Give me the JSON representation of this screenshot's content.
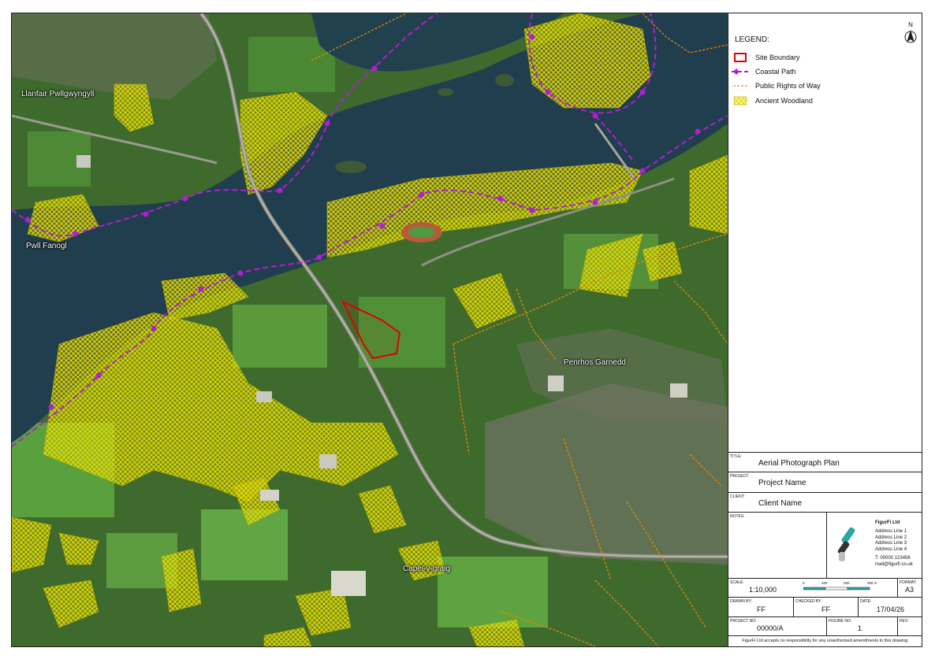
{
  "map": {
    "places": [
      {
        "name": "Llanfair Pwllgwyngyll"
      },
      {
        "name": "Pwll Fanogl"
      },
      {
        "name": "Penrhos Garnedd"
      },
      {
        "name": "Capel-y-graig"
      }
    ]
  },
  "legend": {
    "title": "LEGEND:",
    "items": [
      {
        "label": "Site Boundary",
        "color": "#e00000"
      },
      {
        "label": "Coastal Path",
        "color": "#b01fd0"
      },
      {
        "label": "Public Rights of Way",
        "color": "#f08a00"
      },
      {
        "label": "Ancient Woodland",
        "color": "#f2e600"
      }
    ]
  },
  "north_label": "N",
  "title_block": {
    "title_caption": "TITLE:",
    "title": "Aerial Photograph Plan",
    "project_caption": "PROJECT:",
    "project": "Project Name",
    "client_caption": "CLIENT:",
    "client": "Client Name",
    "notes_caption": "NOTES:",
    "company": {
      "name": "FigurFi Ltd",
      "address": [
        "Address Line 1",
        "Address Line 2",
        "Address Line 3",
        "Address Line 4"
      ],
      "phone": "T: 00000 123456",
      "email": "mail@figurfi.co.uk"
    },
    "scale_caption": "SCALE:",
    "scale": "1:10,000",
    "scalebar_ticks": [
      "0",
      "100",
      "200",
      "300 m"
    ],
    "format_caption": "FORMAT:",
    "format": "A3",
    "drawn_by_caption": "DRAWN BY:",
    "drawn_by": "FF",
    "checked_by_caption": "CHECKED BY:",
    "checked_by": "FF",
    "date_caption": "DATE:",
    "date": "17/04/26",
    "project_no_caption": "PROJECT NO:",
    "project_no": "00000/A",
    "figure_no_caption": "FIGURE NO:",
    "figure_no": "1",
    "rev_caption": "REV:",
    "rev": "",
    "disclaimer": "FigurFi Ltd accepts no responsibility for any unauthorised amendments to this drawing."
  }
}
